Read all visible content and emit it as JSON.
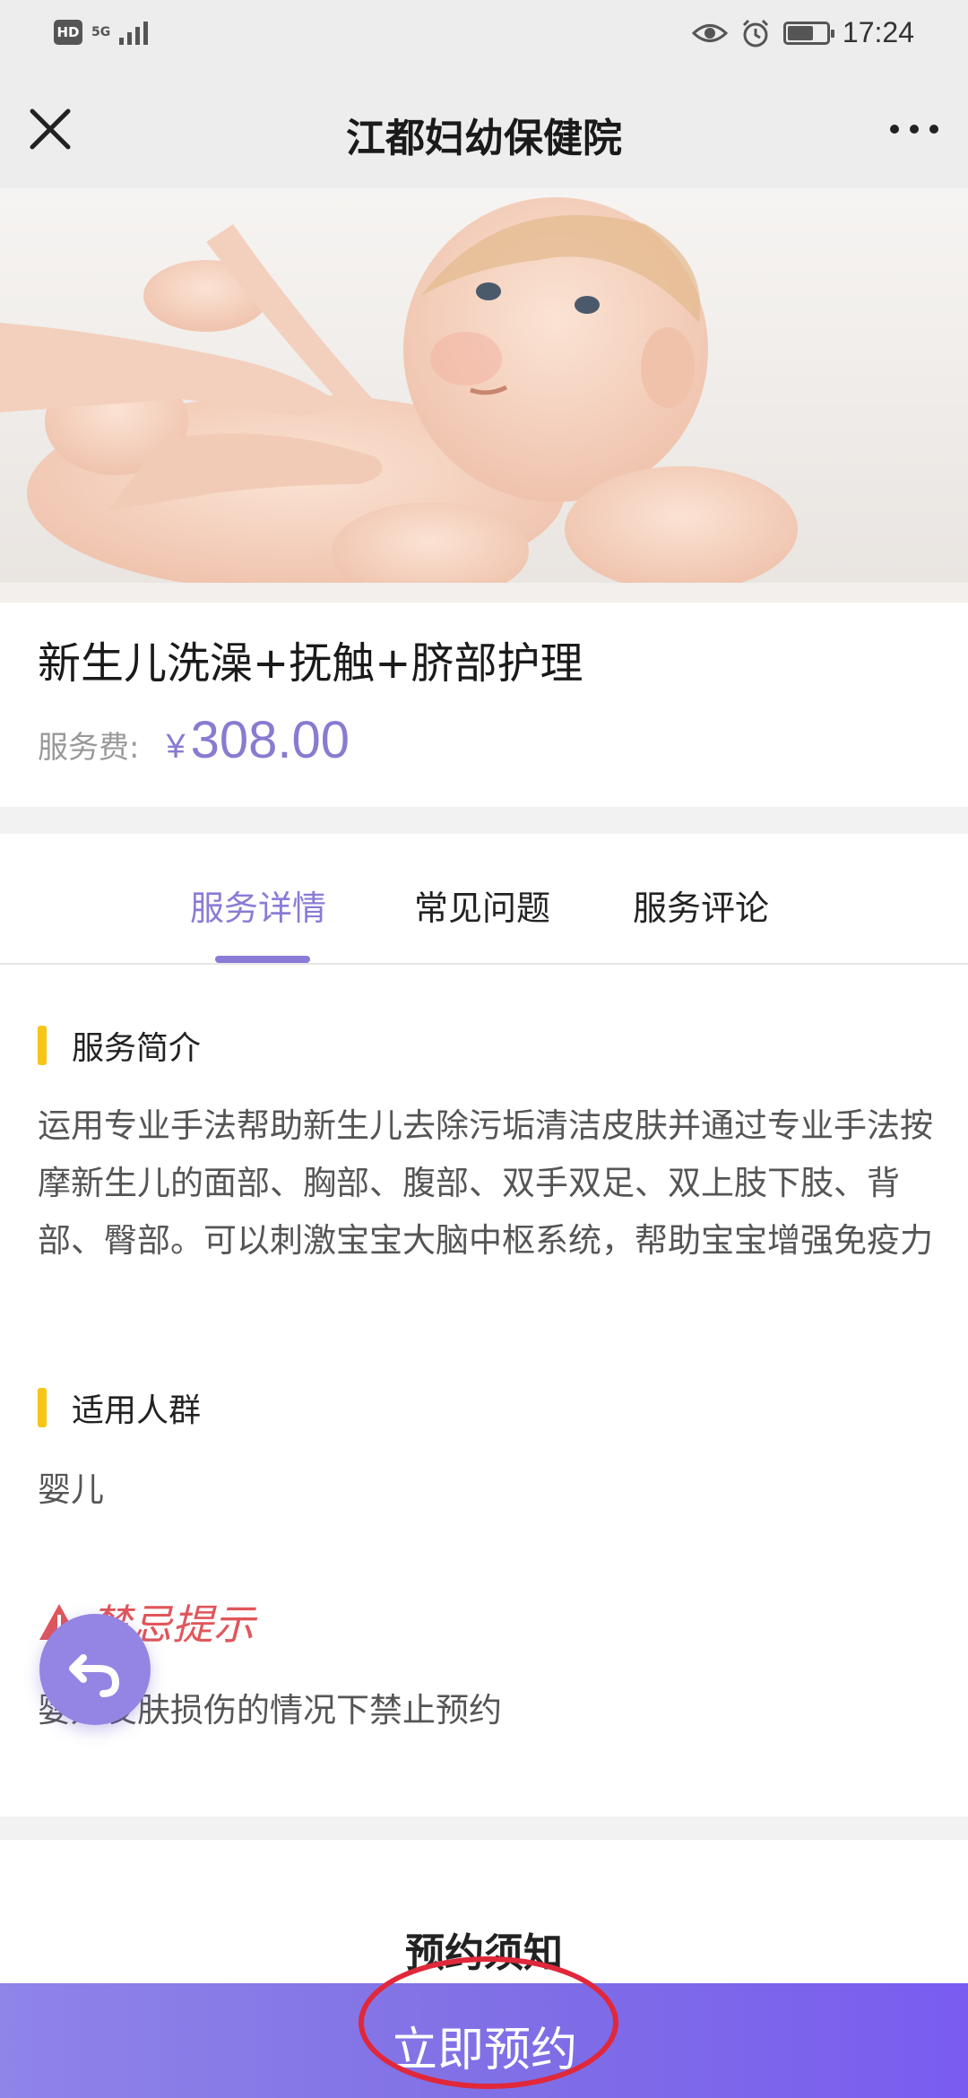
{
  "status_bar": {
    "left_badge": "HD",
    "network": "5G",
    "time": "17:24"
  },
  "nav": {
    "title": "江都妇幼保健院",
    "close_icon": "close-icon",
    "more_icon": "more-icon"
  },
  "product": {
    "title": "新生儿洗澡+抚触+脐部护理",
    "price_label": "服务费:",
    "currency": "¥",
    "price": "308.00"
  },
  "tabs": [
    {
      "label": "服务详情",
      "active": true
    },
    {
      "label": "常见问题",
      "active": false
    },
    {
      "label": "服务评论",
      "active": false
    }
  ],
  "sections": {
    "intro_title": "服务简介",
    "intro_body": "运用专业手法帮助新生儿去除污垢清洁皮肤并通过专业手法按摩新生儿的面部、胸部、腹部、双手双足、双上肢下肢、背部、臀部。可以刺激宝宝大脑中枢系统，帮助宝宝增强免疫力",
    "audience_title": "适用人群",
    "audience_body": "婴儿",
    "warning_title": "禁忌提示",
    "warning_body": "婴儿皮肤损伤的情况下禁止预约"
  },
  "notice": {
    "title": "预约须知"
  },
  "bottom": {
    "book_label": "立即预约"
  },
  "colors": {
    "accent": "#8b7bd6",
    "price": "#8a7ad1",
    "section_marker": "#f5c518",
    "warning": "#e0565b",
    "annotation_circle": "#e0283a"
  }
}
